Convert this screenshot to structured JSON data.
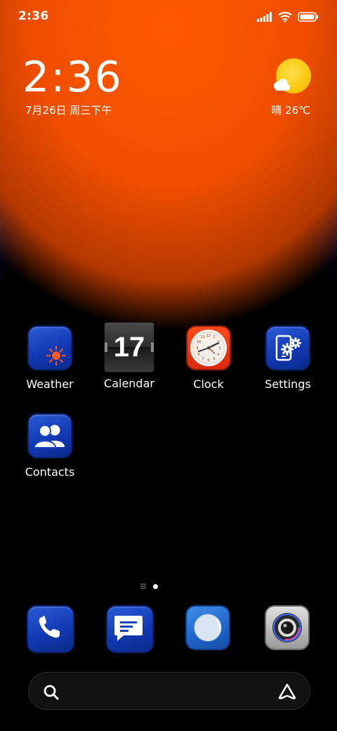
{
  "status_bar": {
    "time": "2:36",
    "icons": [
      "signal-icon",
      "wifi-icon",
      "battery-icon"
    ]
  },
  "clock_widget": {
    "time": "2:36",
    "date": "7月26日 周三下午",
    "weather": "晴 26℃",
    "weather_icon": "sunny-icon"
  },
  "apps": [
    {
      "label": "Weather",
      "icon": "weather-icon"
    },
    {
      "label": "Calendar",
      "icon": "calendar-icon",
      "day": "17"
    },
    {
      "label": "Clock",
      "icon": "clock-icon"
    },
    {
      "label": "Settings",
      "icon": "settings-icon"
    },
    {
      "label": "Contacts",
      "icon": "contacts-icon"
    }
  ],
  "page_indicator": {
    "pages": 2,
    "current": 2
  },
  "dock": [
    {
      "icon": "phone-icon"
    },
    {
      "icon": "messages-icon"
    },
    {
      "icon": "browser-icon"
    },
    {
      "icon": "camera-icon"
    }
  ],
  "search_bar": {
    "left_icon": "search-icon",
    "right_icon": "assistant-icon"
  },
  "colors": {
    "wallpaper_orange": "#ff5a00",
    "app_blue": "#1239b3"
  }
}
